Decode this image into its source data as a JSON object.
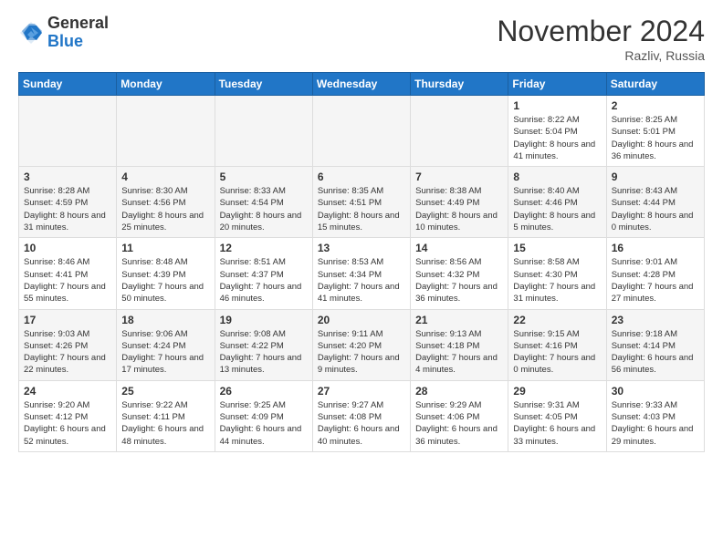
{
  "header": {
    "logo_general": "General",
    "logo_blue": "Blue",
    "month_title": "November 2024",
    "location": "Razliv, Russia"
  },
  "days_of_week": [
    "Sunday",
    "Monday",
    "Tuesday",
    "Wednesday",
    "Thursday",
    "Friday",
    "Saturday"
  ],
  "weeks": [
    [
      {
        "day": "",
        "info": ""
      },
      {
        "day": "",
        "info": ""
      },
      {
        "day": "",
        "info": ""
      },
      {
        "day": "",
        "info": ""
      },
      {
        "day": "",
        "info": ""
      },
      {
        "day": "1",
        "info": "Sunrise: 8:22 AM\nSunset: 5:04 PM\nDaylight: 8 hours and 41 minutes."
      },
      {
        "day": "2",
        "info": "Sunrise: 8:25 AM\nSunset: 5:01 PM\nDaylight: 8 hours and 36 minutes."
      }
    ],
    [
      {
        "day": "3",
        "info": "Sunrise: 8:28 AM\nSunset: 4:59 PM\nDaylight: 8 hours and 31 minutes."
      },
      {
        "day": "4",
        "info": "Sunrise: 8:30 AM\nSunset: 4:56 PM\nDaylight: 8 hours and 25 minutes."
      },
      {
        "day": "5",
        "info": "Sunrise: 8:33 AM\nSunset: 4:54 PM\nDaylight: 8 hours and 20 minutes."
      },
      {
        "day": "6",
        "info": "Sunrise: 8:35 AM\nSunset: 4:51 PM\nDaylight: 8 hours and 15 minutes."
      },
      {
        "day": "7",
        "info": "Sunrise: 8:38 AM\nSunset: 4:49 PM\nDaylight: 8 hours and 10 minutes."
      },
      {
        "day": "8",
        "info": "Sunrise: 8:40 AM\nSunset: 4:46 PM\nDaylight: 8 hours and 5 minutes."
      },
      {
        "day": "9",
        "info": "Sunrise: 8:43 AM\nSunset: 4:44 PM\nDaylight: 8 hours and 0 minutes."
      }
    ],
    [
      {
        "day": "10",
        "info": "Sunrise: 8:46 AM\nSunset: 4:41 PM\nDaylight: 7 hours and 55 minutes."
      },
      {
        "day": "11",
        "info": "Sunrise: 8:48 AM\nSunset: 4:39 PM\nDaylight: 7 hours and 50 minutes."
      },
      {
        "day": "12",
        "info": "Sunrise: 8:51 AM\nSunset: 4:37 PM\nDaylight: 7 hours and 46 minutes."
      },
      {
        "day": "13",
        "info": "Sunrise: 8:53 AM\nSunset: 4:34 PM\nDaylight: 7 hours and 41 minutes."
      },
      {
        "day": "14",
        "info": "Sunrise: 8:56 AM\nSunset: 4:32 PM\nDaylight: 7 hours and 36 minutes."
      },
      {
        "day": "15",
        "info": "Sunrise: 8:58 AM\nSunset: 4:30 PM\nDaylight: 7 hours and 31 minutes."
      },
      {
        "day": "16",
        "info": "Sunrise: 9:01 AM\nSunset: 4:28 PM\nDaylight: 7 hours and 27 minutes."
      }
    ],
    [
      {
        "day": "17",
        "info": "Sunrise: 9:03 AM\nSunset: 4:26 PM\nDaylight: 7 hours and 22 minutes."
      },
      {
        "day": "18",
        "info": "Sunrise: 9:06 AM\nSunset: 4:24 PM\nDaylight: 7 hours and 17 minutes."
      },
      {
        "day": "19",
        "info": "Sunrise: 9:08 AM\nSunset: 4:22 PM\nDaylight: 7 hours and 13 minutes."
      },
      {
        "day": "20",
        "info": "Sunrise: 9:11 AM\nSunset: 4:20 PM\nDaylight: 7 hours and 9 minutes."
      },
      {
        "day": "21",
        "info": "Sunrise: 9:13 AM\nSunset: 4:18 PM\nDaylight: 7 hours and 4 minutes."
      },
      {
        "day": "22",
        "info": "Sunrise: 9:15 AM\nSunset: 4:16 PM\nDaylight: 7 hours and 0 minutes."
      },
      {
        "day": "23",
        "info": "Sunrise: 9:18 AM\nSunset: 4:14 PM\nDaylight: 6 hours and 56 minutes."
      }
    ],
    [
      {
        "day": "24",
        "info": "Sunrise: 9:20 AM\nSunset: 4:12 PM\nDaylight: 6 hours and 52 minutes."
      },
      {
        "day": "25",
        "info": "Sunrise: 9:22 AM\nSunset: 4:11 PM\nDaylight: 6 hours and 48 minutes."
      },
      {
        "day": "26",
        "info": "Sunrise: 9:25 AM\nSunset: 4:09 PM\nDaylight: 6 hours and 44 minutes."
      },
      {
        "day": "27",
        "info": "Sunrise: 9:27 AM\nSunset: 4:08 PM\nDaylight: 6 hours and 40 minutes."
      },
      {
        "day": "28",
        "info": "Sunrise: 9:29 AM\nSunset: 4:06 PM\nDaylight: 6 hours and 36 minutes."
      },
      {
        "day": "29",
        "info": "Sunrise: 9:31 AM\nSunset: 4:05 PM\nDaylight: 6 hours and 33 minutes."
      },
      {
        "day": "30",
        "info": "Sunrise: 9:33 AM\nSunset: 4:03 PM\nDaylight: 6 hours and 29 minutes."
      }
    ]
  ]
}
